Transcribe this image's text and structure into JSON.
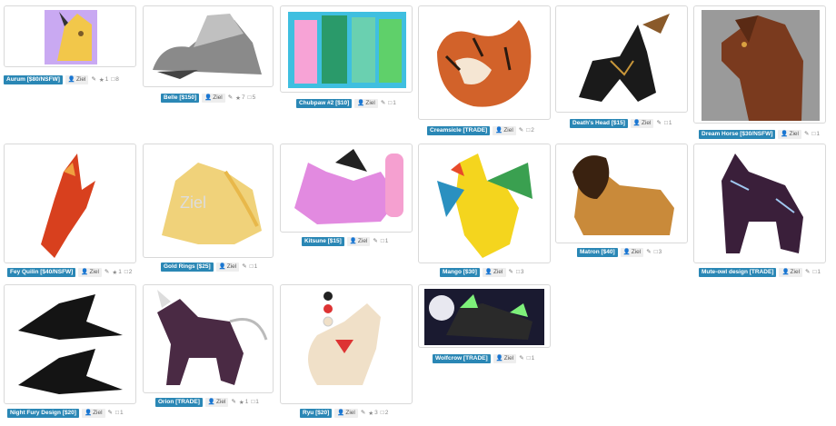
{
  "characters": [
    {
      "name": "Aurum [$80/NSFW]",
      "owner": "Ziel",
      "likes": "1",
      "comments": "8",
      "bg": "#c9a9f2",
      "fg": "#f2c74a"
    },
    {
      "name": "Belle [$150]",
      "owner": "Ziel",
      "likes": "7",
      "comments": "5",
      "bg": "#ffffff",
      "fg": "#666666"
    },
    {
      "name": "Chubpaw #2 [$10]",
      "owner": "Ziel",
      "likes": "",
      "comments": "1",
      "bg": "#3fbfe0",
      "fg": "#5fd06a"
    },
    {
      "name": "Creamsicle [TRADE]",
      "owner": "Ziel",
      "likes": "",
      "comments": "2",
      "bg": "#ffffff",
      "fg": "#d2622a"
    },
    {
      "name": "Death's Head [$15]",
      "owner": "Ziel",
      "likes": "",
      "comments": "1",
      "bg": "#ffffff",
      "fg": "#1a1a1a"
    },
    {
      "name": "Dream Horse [$30/NSFW]",
      "owner": "Ziel",
      "likes": "",
      "comments": "1",
      "bg": "#999999",
      "fg": "#7a3a1e"
    },
    {
      "name": "Fey Quilin [$40/NSFW]",
      "owner": "Ziel",
      "likes": "1",
      "comments": "2",
      "bg": "#ffffff",
      "fg": "#d8401e"
    },
    {
      "name": "Gold Rings [$25]",
      "owner": "Ziel",
      "likes": "",
      "comments": "1",
      "bg": "#ffffff",
      "fg": "#f0d27a"
    },
    {
      "name": "Kitsune [$15]",
      "owner": "Ziel",
      "likes": "",
      "comments": "1",
      "bg": "#ffffff",
      "fg": "#e28ae0"
    },
    {
      "name": "Mango [$30]",
      "owner": "Ziel",
      "likes": "",
      "comments": "3",
      "bg": "#ffffff",
      "fg": "#f4d51e"
    },
    {
      "name": "Matron [$40]",
      "owner": "Ziel",
      "likes": "",
      "comments": "3",
      "bg": "#ffffff",
      "fg": "#c98a3a"
    },
    {
      "name": "Mute-owl design [TRADE]",
      "owner": "Ziel",
      "likes": "",
      "comments": "1",
      "bg": "#ffffff",
      "fg": "#3a1f3a"
    },
    {
      "name": "Night Fury Design [$20]",
      "owner": "Ziel",
      "likes": "",
      "comments": "1",
      "bg": "#ffffff",
      "fg": "#141414"
    },
    {
      "name": "Orion [TRADE]",
      "owner": "Ziel",
      "likes": "1",
      "comments": "1",
      "bg": "#ffffff",
      "fg": "#4a2a44"
    },
    {
      "name": "Ryu [$20]",
      "owner": "Ziel",
      "likes": "3",
      "comments": "2",
      "bg": "#ffffff",
      "fg": "#f0e0c8"
    },
    {
      "name": "Wolfcrow [TRADE]",
      "owner": "Ziel",
      "likes": "",
      "comments": "1",
      "bg": "#1a1a30",
      "fg": "#7ef07a"
    }
  ],
  "icons": {
    "owner": "user-icon",
    "edit": "pencil-icon",
    "like": "star-icon",
    "comment": "comment-icon"
  }
}
